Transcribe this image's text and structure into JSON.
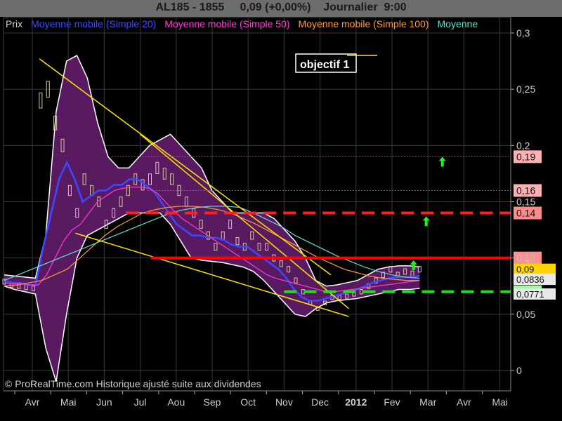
{
  "header": {
    "symbol": "AL185 - 1855",
    "price": "0,09 (+0,00%)",
    "period": "Journalier",
    "time": "9:00"
  },
  "legend": [
    {
      "label": "Prix",
      "color": "#cfcfcf"
    },
    {
      "label": "Moyenne mobile (Simple 20)",
      "color": "#3a4bff"
    },
    {
      "label": "Moyenne mobile (Simple 50)",
      "color": "#ff3ad8"
    },
    {
      "label": "Moyenne mobile (Simple 100)",
      "color": "#ff9a3c"
    },
    {
      "label": "Moyenne",
      "color": "#62e0d0"
    }
  ],
  "annotation_label": "objectif 1",
  "copyright": "© ProRealTime.com Historique ajusté suite aux dividendes",
  "chart_data": {
    "type": "line",
    "ylim": [
      0,
      0.3
    ],
    "y_ticks": [
      {
        "value": 0.3,
        "label": "0,3"
      },
      {
        "value": 0.25,
        "label": "0,25"
      },
      {
        "value": 0.2,
        "label": "0,2"
      },
      {
        "value": 0.15,
        "label": "0,15"
      },
      {
        "value": 0.1,
        "label": "0,10"
      },
      {
        "value": 0.05,
        "label": "0,05"
      },
      {
        "value": 0,
        "label": "0"
      }
    ],
    "x_ticks": [
      {
        "index": 0,
        "label": "Avr"
      },
      {
        "index": 1,
        "label": "Mai"
      },
      {
        "index": 2,
        "label": "Jun"
      },
      {
        "index": 3,
        "label": "Jul"
      },
      {
        "index": 4,
        "label": "Aou"
      },
      {
        "index": 5,
        "label": "Sep"
      },
      {
        "index": 6,
        "label": "Oct"
      },
      {
        "index": 7,
        "label": "Nov"
      },
      {
        "index": 8,
        "label": "Dec"
      },
      {
        "index": 9,
        "label": "2012"
      },
      {
        "index": 10,
        "label": "Fev"
      },
      {
        "index": 11,
        "label": "Mar"
      },
      {
        "index": 12,
        "label": "Avr"
      },
      {
        "index": 13,
        "label": "Mai"
      }
    ],
    "grid": true,
    "levels": [
      {
        "value": 0.19,
        "label": "0,19",
        "style": "dotted",
        "color": "#ff2a2a",
        "label_bg": "#ffb0b0",
        "x_start_month": 2.2
      },
      {
        "value": 0.16,
        "label": "0,16",
        "style": "dotted",
        "color": "#ff2a2a",
        "label_bg": "#ffb0b0",
        "x_start_month": 3.2
      },
      {
        "value": 0.14,
        "label": "0,14",
        "style": "dashed",
        "color": "#ff2020",
        "label_bg": "#ff8a8a",
        "x_start_month": 2.6
      },
      {
        "value": 0.1,
        "label": "0,10",
        "style": "solid",
        "color": "#ff0000",
        "label_bg": "#ff9090",
        "x_start_month": 3.3
      },
      {
        "value": 0.07,
        "label": "0,07",
        "style": "dashed",
        "color": "#22dd22",
        "label_bg": "#9cff9c",
        "x_start_month": 7.0
      }
    ],
    "right_labels": [
      {
        "value": 0.09,
        "label": "0,09",
        "bg": "#ffd400"
      },
      {
        "value": 0.081,
        "label": "0,0836",
        "bg": "#e8e8e8"
      },
      {
        "value": 0.068,
        "label": "0,0771",
        "bg": "#e8e8e8"
      }
    ],
    "trendlines": [
      {
        "name": "upper",
        "color": "#ffe600",
        "points": [
          [
            0.2,
            0.277
          ],
          [
            8.3,
            0.085
          ]
        ]
      },
      {
        "name": "lower",
        "color": "#ffe600",
        "points": [
          [
            1.2,
            0.122
          ],
          [
            8.8,
            0.048
          ]
        ]
      },
      {
        "name": "mid",
        "color": "#ffe600",
        "points": [
          [
            3.0,
            0.21
          ],
          [
            8.8,
            0.055
          ]
        ]
      }
    ],
    "arrows": [
      {
        "x_month": 11.4,
        "value": 0.185
      },
      {
        "x_month": 10.95,
        "value": 0.132
      },
      {
        "x_month": 10.6,
        "value": 0.093
      }
    ],
    "series": [
      {
        "name": "Prix",
        "color": "#d8c8a8",
        "values": [
          0.079,
          0.076,
          0.075,
          0.074,
          0.073,
          0.24,
          0.25,
          0.22,
          0.2,
          0.16,
          0.14,
          0.17,
          0.16,
          0.15,
          0.13,
          0.14,
          0.15,
          0.16,
          0.17,
          0.165,
          0.17,
          0.18,
          0.175,
          0.17,
          0.16,
          0.15,
          0.14,
          0.13,
          0.12,
          0.11,
          0.12,
          0.13,
          0.115,
          0.11,
          0.12,
          0.11,
          0.11,
          0.1,
          0.095,
          0.09,
          0.08,
          0.07,
          0.06,
          0.055,
          0.06,
          0.065,
          0.065,
          0.066,
          0.068,
          0.07,
          0.075,
          0.08,
          0.085,
          0.09,
          0.085,
          0.088,
          0.086,
          0.09
        ]
      },
      {
        "name": "Moyenne mobile (Simple 20)",
        "color": "#3a4bff",
        "values": [
          0.08,
          0.078,
          0.078,
          0.076,
          0.076,
          0.11,
          0.14,
          0.17,
          0.185,
          0.17,
          0.15,
          0.155,
          0.16,
          0.16,
          0.165,
          0.165,
          0.17,
          0.17,
          0.165,
          0.16,
          0.15,
          0.14,
          0.13,
          0.125,
          0.12,
          0.12,
          0.118,
          0.118,
          0.116,
          0.112,
          0.11,
          0.11,
          0.105,
          0.1,
          0.095,
          0.09,
          0.082,
          0.072,
          0.065,
          0.062,
          0.062,
          0.064,
          0.066,
          0.068,
          0.07,
          0.072,
          0.075,
          0.078,
          0.08,
          0.082,
          0.083,
          0.083,
          0.083,
          0.084
        ]
      },
      {
        "name": "Moyenne mobile (Simple 50)",
        "color": "#ff3ad8",
        "values": [
          0.078,
          0.077,
          0.077,
          0.076,
          0.076,
          0.085,
          0.1,
          0.115,
          0.125,
          0.13,
          0.14,
          0.15,
          0.155,
          0.16,
          0.162,
          0.163,
          0.163,
          0.162,
          0.158,
          0.15,
          0.142,
          0.135,
          0.13,
          0.125,
          0.12,
          0.115,
          0.11,
          0.105,
          0.1,
          0.095,
          0.09,
          0.085,
          0.082,
          0.08,
          0.078,
          0.076,
          0.074,
          0.072,
          0.07,
          0.07,
          0.071,
          0.072,
          0.073,
          0.074,
          0.075,
          0.076,
          0.077,
          0.078,
          0.079,
          0.08
        ]
      },
      {
        "name": "Moyenne mobile (Simple 100)",
        "color": "#ff9a3c",
        "values": [
          0.075,
          0.076,
          0.078,
          0.08,
          0.085,
          0.09,
          0.1,
          0.11,
          0.12,
          0.128,
          0.134,
          0.14,
          0.143,
          0.145,
          0.146,
          0.146,
          0.145,
          0.143,
          0.14,
          0.135,
          0.13,
          0.124,
          0.118,
          0.112,
          0.106,
          0.1,
          0.095,
          0.09,
          0.087,
          0.084,
          0.082,
          0.081,
          0.08,
          0.08
        ]
      },
      {
        "name": "Moyenne",
        "color": "#62e0d0",
        "values": [
          0.08,
          0.085,
          0.09,
          0.095,
          0.1,
          0.105,
          0.11,
          0.115,
          0.12,
          0.125,
          0.13,
          0.135,
          0.14,
          0.143,
          0.145,
          0.146,
          0.146,
          0.145,
          0.14,
          0.134,
          0.128,
          0.12,
          0.114,
          0.108,
          0.102,
          0.097,
          0.092,
          0.088,
          0.085,
          0.083,
          0.082
        ]
      }
    ],
    "band_upper": [
      0.085,
      0.084,
      0.083,
      0.082,
      0.12,
      0.23,
      0.275,
      0.28,
      0.26,
      0.22,
      0.19,
      0.18,
      0.18,
      0.19,
      0.2,
      0.205,
      0.21,
      0.2,
      0.19,
      0.18,
      0.16,
      0.15,
      0.14,
      0.14,
      0.14,
      0.14,
      0.135,
      0.125,
      0.115,
      0.1,
      0.08,
      0.075,
      0.076,
      0.078,
      0.08,
      0.085,
      0.09,
      0.092,
      0.093,
      0.093,
      0.092
    ],
    "band_lower": [
      0.075,
      0.072,
      0.07,
      0.068,
      0.02,
      -0.01,
      0.05,
      0.1,
      0.12,
      0.125,
      0.13,
      0.135,
      0.14,
      0.14,
      0.14,
      0.14,
      0.13,
      0.115,
      0.1,
      0.098,
      0.097,
      0.096,
      0.094,
      0.092,
      0.088,
      0.08,
      0.07,
      0.06,
      0.05,
      0.048,
      0.055,
      0.06,
      0.062,
      0.063,
      0.064,
      0.066,
      0.068,
      0.07,
      0.072,
      0.072,
      0.073
    ]
  }
}
